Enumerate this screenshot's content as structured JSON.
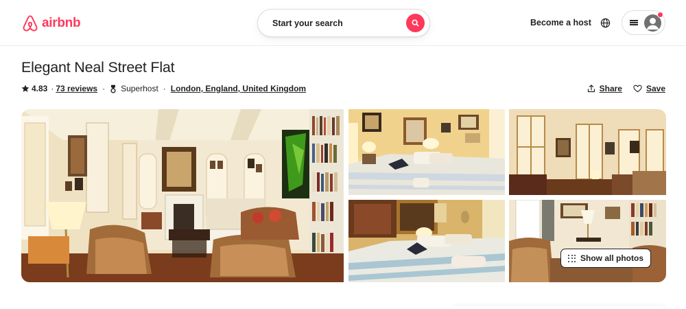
{
  "header": {
    "logo_text": "airbnb",
    "search_placeholder": "Start your search",
    "become_host": "Become a host"
  },
  "listing": {
    "title": "Elegant Neal Street Flat",
    "rating": "4.83",
    "reviews": "73 reviews",
    "badge": "Superhost",
    "location": "London, England, United Kingdom",
    "share_label": "Share",
    "save_label": "Save"
  },
  "gallery": {
    "show_all_label": "Show all photos",
    "photos": [
      "living-room",
      "bedroom-1",
      "sitting-room-windows",
      "bedroom-2",
      "lounge-lamp"
    ]
  },
  "colors": {
    "brand": "#ff385c",
    "text": "#222222",
    "border": "#dddddd"
  },
  "icons": [
    "airbnb-logo-icon",
    "search-icon",
    "globe-icon",
    "menu-icon",
    "user-avatar-icon",
    "star-icon",
    "superhost-icon",
    "share-icon",
    "heart-icon",
    "grid-dots-icon"
  ]
}
